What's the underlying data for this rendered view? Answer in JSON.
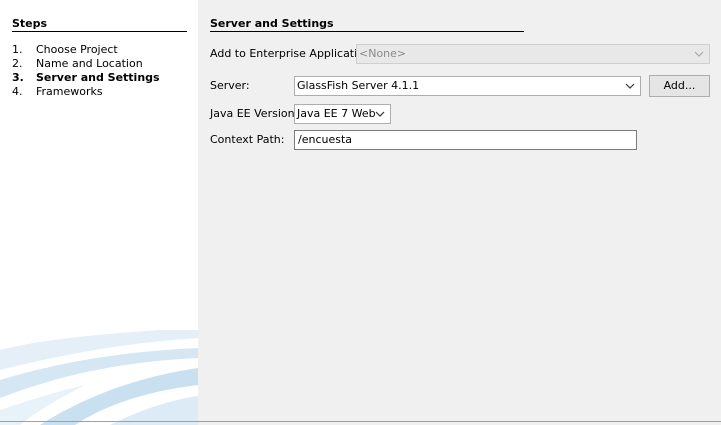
{
  "steps": {
    "title": "Steps",
    "items": [
      {
        "num": "1.",
        "label": "Choose Project",
        "active": false
      },
      {
        "num": "2.",
        "label": "Name and Location",
        "active": false
      },
      {
        "num": "3.",
        "label": "Server and Settings",
        "active": true
      },
      {
        "num": "4.",
        "label": "Frameworks",
        "active": false
      }
    ]
  },
  "main": {
    "title": "Server and Settings",
    "enterprise_app": {
      "label": "Add to Enterprise Application:",
      "value": "<None>",
      "disabled": true
    },
    "server": {
      "label": "Server:",
      "value": "GlassFish Server 4.1.1",
      "add_button": "Add..."
    },
    "java_ee": {
      "label": "Java EE Version:",
      "value": "Java EE 7 Web"
    },
    "context_path": {
      "label": "Context Path:",
      "value": "/encuesta"
    }
  },
  "colors": {
    "panel_bg": "#f0f0f0",
    "steps_bg": "#ffffff",
    "swoosh": "#cfe3f1"
  },
  "icons": [
    "chevron-down-icon",
    "wizard-swoosh-graphic"
  ]
}
